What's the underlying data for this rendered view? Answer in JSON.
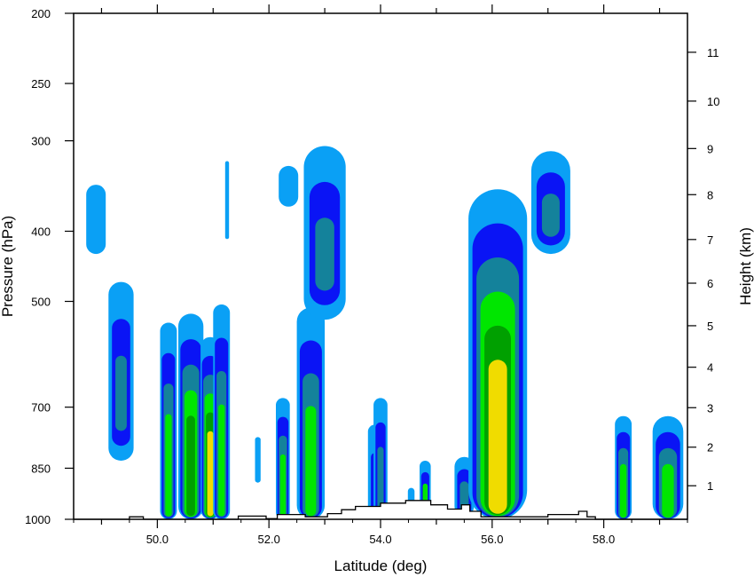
{
  "chart_data": {
    "type": "heatmap",
    "title": "",
    "xlabel": "Latitude (deg)",
    "ylabel_left": "Pressure (hPa)",
    "ylabel_right": "Height (km)",
    "xlim": [
      48.5,
      59.5
    ],
    "pressure_range": [
      1000,
      200
    ],
    "pressure_scale": "log",
    "x_ticks": [
      50.0,
      52.0,
      54.0,
      56.0,
      58.0
    ],
    "x_tick_labels": [
      "50.0",
      "52.0",
      "54.0",
      "56.0",
      "58.0"
    ],
    "pressure_ticks": [
      200,
      250,
      300,
      400,
      500,
      700,
      850,
      1000
    ],
    "pressure_tick_labels": [
      "200",
      "250",
      "300",
      "400",
      "500",
      "700",
      "850",
      "1000"
    ],
    "height_ticks_km": [
      1,
      2,
      3,
      4,
      5,
      6,
      7,
      8,
      9,
      10,
      11
    ],
    "height_tick_labels": [
      "1",
      "2",
      "3",
      "4",
      "5",
      "6",
      "7",
      "8",
      "9",
      "10",
      "11"
    ],
    "grid": false,
    "legend": "none",
    "colors": {
      "level1": "#0aa0f5",
      "level2": "#0a14f5",
      "level3": "#14829b",
      "level4": "#00e600",
      "level5": "#00a000",
      "level6": "#f0dc00",
      "terrain": "#000000"
    },
    "cells": [
      {
        "lat": 48.9,
        "top_p": 345,
        "bottom_p": 430,
        "width": 0.35,
        "levels": [
          1
        ]
      },
      {
        "lat": 49.35,
        "top_p": 470,
        "bottom_p": 830,
        "width": 0.45,
        "levels": [
          1,
          2,
          3
        ]
      },
      {
        "lat": 50.2,
        "top_p": 535,
        "bottom_p": 1000,
        "width": 0.3,
        "levels": [
          1,
          2,
          3,
          4
        ]
      },
      {
        "lat": 50.6,
        "top_p": 520,
        "bottom_p": 1000,
        "width": 0.45,
        "levels": [
          1,
          2,
          3,
          4,
          5
        ]
      },
      {
        "lat": 50.95,
        "top_p": 560,
        "bottom_p": 1000,
        "width": 0.35,
        "levels": [
          1,
          2,
          3,
          4,
          5,
          6
        ]
      },
      {
        "lat": 51.15,
        "top_p": 505,
        "bottom_p": 1000,
        "width": 0.3,
        "levels": [
          1,
          2,
          3,
          4
        ]
      },
      {
        "lat": 51.25,
        "top_p": 320,
        "bottom_p": 410,
        "width": 0.07,
        "levels": [
          1
        ]
      },
      {
        "lat": 51.8,
        "top_p": 770,
        "bottom_p": 890,
        "width": 0.1,
        "levels": [
          1
        ]
      },
      {
        "lat": 52.25,
        "top_p": 680,
        "bottom_p": 1000,
        "width": 0.25,
        "levels": [
          1,
          2,
          3,
          4
        ]
      },
      {
        "lat": 52.35,
        "top_p": 325,
        "bottom_p": 370,
        "width": 0.35,
        "levels": [
          1
        ]
      },
      {
        "lat": 52.75,
        "top_p": 510,
        "bottom_p": 1000,
        "width": 0.5,
        "levels": [
          1,
          2,
          3,
          4
        ]
      },
      {
        "lat": 53.0,
        "top_p": 305,
        "bottom_p": 530,
        "width": 0.75,
        "levels": [
          1,
          2,
          3
        ]
      },
      {
        "lat": 53.9,
        "top_p": 740,
        "bottom_p": 990,
        "width": 0.25,
        "levels": [
          1,
          2
        ]
      },
      {
        "lat": 54.0,
        "top_p": 680,
        "bottom_p": 990,
        "width": 0.25,
        "levels": [
          1,
          2,
          3
        ]
      },
      {
        "lat": 54.55,
        "top_p": 905,
        "bottom_p": 990,
        "width": 0.12,
        "levels": [
          1
        ]
      },
      {
        "lat": 54.8,
        "top_p": 830,
        "bottom_p": 990,
        "width": 0.2,
        "levels": [
          1,
          2,
          4
        ]
      },
      {
        "lat": 55.5,
        "top_p": 820,
        "bottom_p": 990,
        "width": 0.35,
        "levels": [
          1,
          2,
          3
        ]
      },
      {
        "lat": 56.1,
        "top_p": 350,
        "bottom_p": 1000,
        "width": 1.05,
        "levels": [
          1,
          2,
          3,
          4,
          5,
          6
        ]
      },
      {
        "lat": 57.05,
        "top_p": 310,
        "bottom_p": 430,
        "width": 0.7,
        "levels": [
          1,
          2,
          3
        ]
      },
      {
        "lat": 58.35,
        "top_p": 720,
        "bottom_p": 1000,
        "width": 0.3,
        "levels": [
          1,
          2,
          3,
          4
        ]
      },
      {
        "lat": 59.15,
        "top_p": 720,
        "bottom_p": 1000,
        "width": 0.55,
        "levels": [
          1,
          2,
          3,
          4
        ]
      }
    ],
    "terrain_profile": [
      {
        "lat": 48.5,
        "p": 1000
      },
      {
        "lat": 49.5,
        "p": 1000
      },
      {
        "lat": 49.5,
        "p": 992
      },
      {
        "lat": 49.75,
        "p": 992
      },
      {
        "lat": 49.75,
        "p": 1000
      },
      {
        "lat": 51.45,
        "p": 1000
      },
      {
        "lat": 51.45,
        "p": 990
      },
      {
        "lat": 51.95,
        "p": 990
      },
      {
        "lat": 51.95,
        "p": 998
      },
      {
        "lat": 52.15,
        "p": 998
      },
      {
        "lat": 52.15,
        "p": 985
      },
      {
        "lat": 52.65,
        "p": 985
      },
      {
        "lat": 52.65,
        "p": 992
      },
      {
        "lat": 53.05,
        "p": 992
      },
      {
        "lat": 53.05,
        "p": 982
      },
      {
        "lat": 53.3,
        "p": 982
      },
      {
        "lat": 53.3,
        "p": 970
      },
      {
        "lat": 53.55,
        "p": 970
      },
      {
        "lat": 53.55,
        "p": 960
      },
      {
        "lat": 54.0,
        "p": 960
      },
      {
        "lat": 54.0,
        "p": 950
      },
      {
        "lat": 54.45,
        "p": 950
      },
      {
        "lat": 54.45,
        "p": 942
      },
      {
        "lat": 54.9,
        "p": 942
      },
      {
        "lat": 54.9,
        "p": 955
      },
      {
        "lat": 55.2,
        "p": 955
      },
      {
        "lat": 55.2,
        "p": 968
      },
      {
        "lat": 55.45,
        "p": 968
      },
      {
        "lat": 55.45,
        "p": 955
      },
      {
        "lat": 55.6,
        "p": 955
      },
      {
        "lat": 55.6,
        "p": 975
      },
      {
        "lat": 55.8,
        "p": 975
      },
      {
        "lat": 55.8,
        "p": 992
      },
      {
        "lat": 57.0,
        "p": 992
      },
      {
        "lat": 57.0,
        "p": 985
      },
      {
        "lat": 57.55,
        "p": 985
      },
      {
        "lat": 57.55,
        "p": 975
      },
      {
        "lat": 57.7,
        "p": 975
      },
      {
        "lat": 57.7,
        "p": 992
      },
      {
        "lat": 57.85,
        "p": 992
      },
      {
        "lat": 57.85,
        "p": 1000
      },
      {
        "lat": 59.5,
        "p": 1000
      }
    ]
  }
}
